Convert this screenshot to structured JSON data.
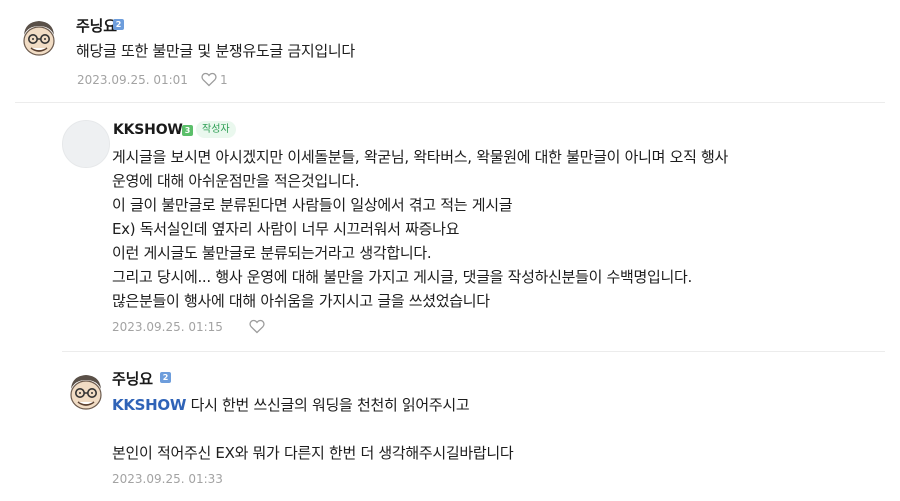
{
  "comments": [
    {
      "nickname": "주닝요",
      "level": "2",
      "lines": [
        "해당글 또한 불만글 및 분쟁유도글 금지입니다"
      ],
      "date": "2023.09.25. 01:01",
      "like_count": "1"
    },
    {
      "nickname": "KKSHOW",
      "level": "3",
      "badge": "작성자",
      "lines": [
        "게시글을 보시면 아시겠지만 이세돌분들, 왁굳님, 왁타버스, 왁물원에 대한 불만글이 아니며 오직 행사",
        "운영에 대해 아쉬운점만을 적은것입니다.",
        "이 글이 불만글로 분류된다면 사람들이 일상에서 겪고 적는 게시글",
        "Ex) 독서실인데 옆자리 사람이 너무 시끄러워서 짜증나요",
        "이런 게시글도 불만글로 분류되는거라고 생각합니다.",
        "그리고 당시에... 행사 운영에 대해 불만을 가지고 게시글, 댓글을 작성하신분들이 수백명입니다.",
        "많은분들이 행사에 대해 아쉬움을 가지시고 글을 쓰셨었습니다"
      ],
      "date": "2023.09.25. 01:15"
    },
    {
      "nickname": "주닝요",
      "level": "2",
      "mention": "KKSHOW",
      "first_line_rest": " 다시 한번 쓰신글의 워딩을 천천히 읽어주시고",
      "second_line": "본인이 적어주신 EX와 뭐가 다른지 한번 더 생각해주시길바랍니다",
      "date": "2023.09.25. 01:33"
    }
  ],
  "icons": {
    "avatar_cartoon": "cartoon-face-avatar",
    "avatar_default": "default-profile-avatar",
    "like": "heart-outline-icon"
  },
  "colors": {
    "mention": "#2f63b7",
    "level_blue": "#6d9ddc",
    "level_green": "#5bbf6a",
    "badge_text": "#2f9f55",
    "badge_bg": "#eaf8ee",
    "meta": "#a3a3a3"
  }
}
